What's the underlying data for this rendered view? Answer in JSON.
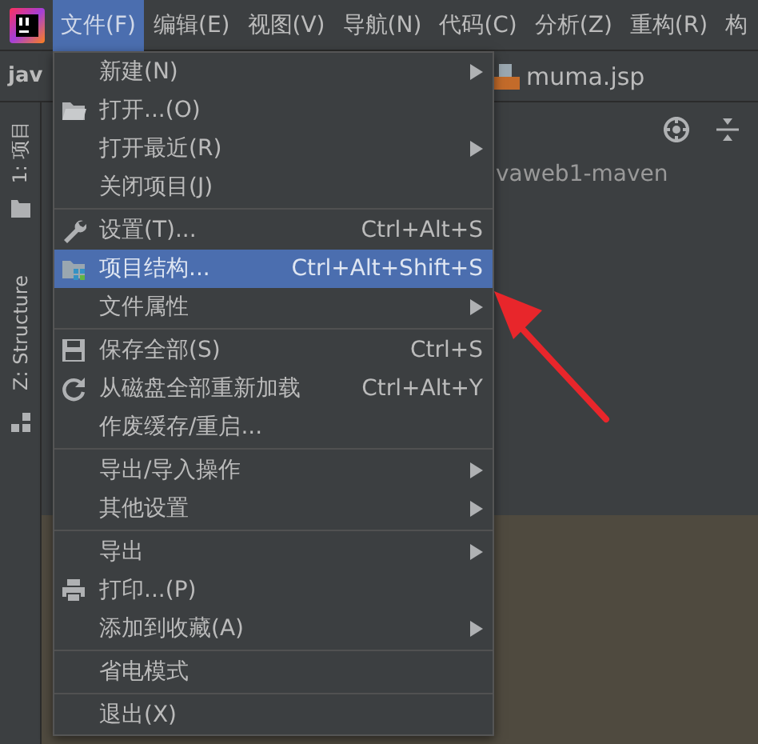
{
  "menu_bar": {
    "items": [
      {
        "label": "文件(F)",
        "selected": true
      },
      {
        "label": "编辑(E)",
        "selected": false
      },
      {
        "label": "视图(V)",
        "selected": false
      },
      {
        "label": "导航(N)",
        "selected": false
      },
      {
        "label": "代码(C)",
        "selected": false
      },
      {
        "label": "分析(Z)",
        "selected": false
      },
      {
        "label": "重构(R)",
        "selected": false
      },
      {
        "label": "构",
        "selected": false
      }
    ]
  },
  "editor_tabs": [
    {
      "label": "jav",
      "kind": "plain"
    },
    {
      "label": "muma.jsp",
      "kind": "jsp"
    }
  ],
  "tool_window_tabs": [
    {
      "label": "1: 项目",
      "kind": "folder"
    },
    {
      "label": "Z: Structure",
      "kind": "structure"
    }
  ],
  "project_tree": {
    "root": "vaweb1-maven"
  },
  "file_menu": {
    "items": [
      {
        "kind": "item",
        "label": "新建(N)",
        "submenu": true,
        "selected": false
      },
      {
        "kind": "item",
        "label": "打开...(O)",
        "selected": false
      },
      {
        "kind": "item",
        "label": "打开最近(R)",
        "submenu": true,
        "selected": false
      },
      {
        "kind": "item",
        "label": "关闭项目(J)",
        "selected": false
      },
      {
        "kind": "separator"
      },
      {
        "kind": "item",
        "label": "设置(T)...",
        "shortcut": "Ctrl+Alt+S",
        "selected": false
      },
      {
        "kind": "item",
        "label": "项目结构...",
        "shortcut": "Ctrl+Alt+Shift+S",
        "selected": true
      },
      {
        "kind": "item",
        "label": "文件属性",
        "submenu": true,
        "selected": false
      },
      {
        "kind": "separator"
      },
      {
        "kind": "item",
        "label": "保存全部(S)",
        "shortcut": "Ctrl+S",
        "selected": false
      },
      {
        "kind": "item",
        "label": "从磁盘全部重新加载",
        "shortcut": "Ctrl+Alt+Y",
        "selected": false
      },
      {
        "kind": "item",
        "label": "作废缓存/重启...",
        "selected": false
      },
      {
        "kind": "separator"
      },
      {
        "kind": "item",
        "label": "导出/导入操作",
        "submenu": true,
        "selected": false
      },
      {
        "kind": "item",
        "label": "其他设置",
        "submenu": true,
        "selected": false
      },
      {
        "kind": "separator"
      },
      {
        "kind": "item",
        "label": "导出",
        "submenu": true,
        "selected": false
      },
      {
        "kind": "item",
        "label": "打印...(P)",
        "selected": false
      },
      {
        "kind": "item",
        "label": "添加到收藏(A)",
        "submenu": true,
        "selected": false
      },
      {
        "kind": "separator"
      },
      {
        "kind": "item",
        "label": "省电模式",
        "selected": false
      },
      {
        "kind": "separator"
      },
      {
        "kind": "item",
        "label": "退出(X)",
        "selected": false
      }
    ]
  }
}
